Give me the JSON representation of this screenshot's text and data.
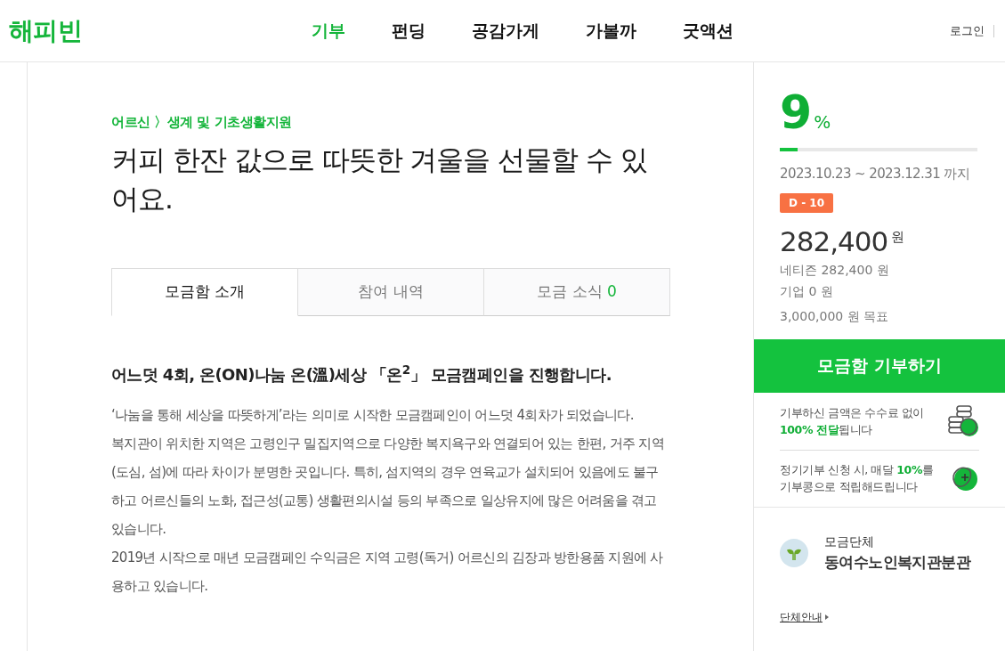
{
  "header": {
    "logo": "해피빈",
    "nav": [
      {
        "label": "기부",
        "selected": true
      },
      {
        "label": "펀딩",
        "selected": false
      },
      {
        "label": "공감가게",
        "selected": false
      },
      {
        "label": "가볼까",
        "selected": false
      },
      {
        "label": "굿액션",
        "selected": false
      }
    ],
    "login": "로그인"
  },
  "campaign": {
    "category": "어르신 〉생계 및 기초생활지원",
    "title": "커피 한잔 값으로 따뜻한 겨울을 선물할 수 있어요.",
    "tabs": [
      {
        "label": "모금함 소개",
        "selected": true
      },
      {
        "label": "참여 내역",
        "selected": false
      },
      {
        "label": "모금 소식",
        "count": "0",
        "selected": false
      }
    ],
    "heading": "어느덧 4회, 온(ON)나눔 온(溫)세상 「온$^{2}$」 모금캠페인을 진행합니다.",
    "paragraphs": [
      "‘나눔을 통해 세상을 따뜻하게’라는 의미로 시작한 모금캠페인이 어느덧 4회차가 되었습니다.",
      "복지관이 위치한 지역은 고령인구 밀집지역으로 다양한 복지욕구와 연결되어 있는 한편, 거주 지역(도심, 섬)에 따라 차이가 분명한 곳입니다. 특히, 섬지역의 경우 연육교가 설치되어 있음에도 불구하고 어르신들의 노화, 접근성(교통) 생활편의시설 등의 부족으로 일상유지에 많은 어려움을 겪고 있습니다.",
      "2019년 시작으로 매년 모금캠페인 수익금은 지역 고령(독거) 어르신의 김장과 방한용품 지원에 사용하고 있습니다."
    ]
  },
  "sidebar": {
    "percent": "9",
    "percent_unit": "%",
    "progress": {
      "level": 0.09
    },
    "period": "2023.10.23 ~ 2023.12.31",
    "period_suffix": "까지",
    "dday": "D - 10",
    "amount": "282,400",
    "amount_unit": "원",
    "netizen": "네티즌 282,400 원",
    "company": "기업 0 원",
    "goal": "3,000,000 원 목표",
    "donate_button": "모금함 기부하기",
    "notes": [
      {
        "kind": "coins",
        "segments": [
          {
            "text": "기부하신 금액은 수수료 없이 ",
            "highlight": false
          },
          {
            "text": "100% 전달",
            "highlight": true
          },
          {
            "text": "됩니다",
            "highlight": false
          }
        ]
      },
      {
        "kind": "bean",
        "segments": [
          {
            "text": "정기기부 신청 시, 매달 ",
            "highlight": false
          },
          {
            "text": "10%",
            "highlight": true
          },
          {
            "text": "를 기부콩으로 적립해드립니다",
            "highlight": false
          }
        ]
      }
    ],
    "org_label": "모금단체",
    "org_name": "동여수노인복지관분관",
    "org_link": "단체안내"
  }
}
